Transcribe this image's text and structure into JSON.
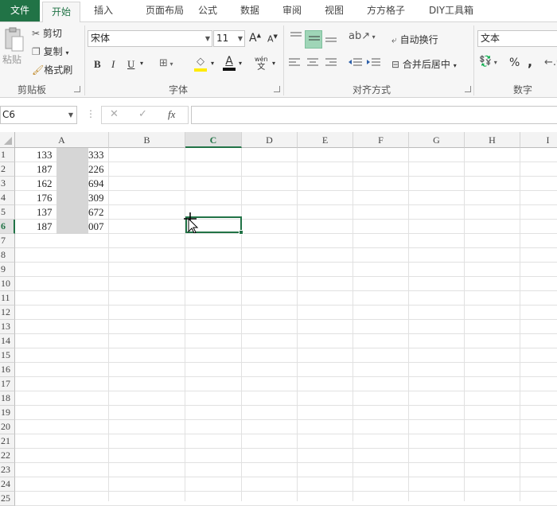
{
  "tabs": [
    "文件",
    "开始",
    "插入",
    "页面布局",
    "公式",
    "数据",
    "审阅",
    "视图",
    "方方格子",
    "DIY工具箱"
  ],
  "clipboard": {
    "paste": "粘贴",
    "cut": "剪切",
    "copy": "复制",
    "format_painter": "格式刷",
    "group": "剪贴板"
  },
  "font": {
    "name": "宋体",
    "size": "11",
    "bold": "B",
    "italic": "I",
    "underline": "U",
    "font_color_glyph": "A",
    "phonetic_top": "wén",
    "phonetic_bottom": "文",
    "grow": "A",
    "shrink": "A",
    "group": "字体"
  },
  "align": {
    "wrap": "自动换行",
    "merge": "合并后居中",
    "group": "对齐方式"
  },
  "number": {
    "format": "文本",
    "percent": "%",
    "comma": ",",
    "group": "数字"
  },
  "formula_bar": {
    "name_box": "C6",
    "fx": "fx",
    "cancel": "✕",
    "enter": "✓"
  },
  "columns": [
    "A",
    "B",
    "C",
    "D",
    "E",
    "F",
    "G",
    "H",
    "I"
  ],
  "selected_column": "C",
  "rows": [
    "1",
    "2",
    "3",
    "4",
    "5",
    "6",
    "7",
    "8",
    "9",
    "10",
    "11",
    "12",
    "13",
    "14",
    "15",
    "16",
    "17",
    "18",
    "19",
    "20",
    "21",
    "22",
    "23",
    "24",
    "25"
  ],
  "selected_row": "6",
  "cells_a": [
    {
      "left": "133",
      "right": "333"
    },
    {
      "left": "187",
      "right": "226"
    },
    {
      "left": "162",
      "right": "694"
    },
    {
      "left": "176",
      "right": "309"
    },
    {
      "left": "137",
      "right": "672"
    },
    {
      "left": "187",
      "right": "007"
    }
  ],
  "colors": {
    "accent": "#217346",
    "redacted": "#d6d6d6"
  }
}
